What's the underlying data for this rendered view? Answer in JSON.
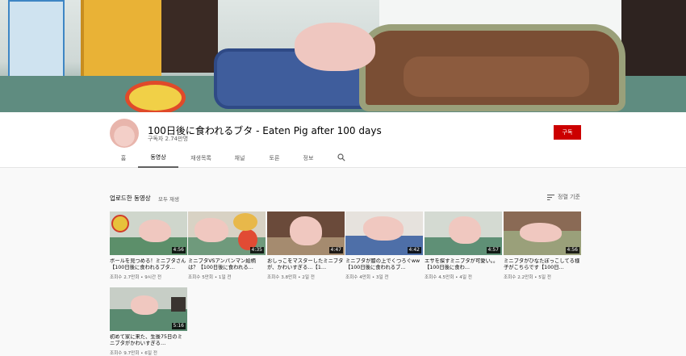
{
  "channel": {
    "title": "100日後に食われるブタ - Eaten Pig after 100 days",
    "subscribers": "구독자 2.74만명",
    "subscribe_label": "구독"
  },
  "tabs": [
    {
      "label": "홈",
      "active": false
    },
    {
      "label": "동영상",
      "active": true
    },
    {
      "label": "재생목록",
      "active": false
    },
    {
      "label": "채널",
      "active": false
    },
    {
      "label": "토론",
      "active": false
    },
    {
      "label": "정보",
      "active": false
    }
  ],
  "section": {
    "title": "업로드한 동영상",
    "play_all": "모두 재생",
    "sort_label": "정렬 기준"
  },
  "icons": {
    "search": "search-icon",
    "sort": "sort-icon"
  },
  "colors": {
    "subscribe": "#cc0000",
    "tab_active_underline": "#606060",
    "duration_bg": "#000000"
  },
  "videos": [
    {
      "duration": "4:56",
      "title": "ボールを見つめる！ミニブタさん【100日後に食われるブタ…",
      "meta": "조회수 2.7만회 • 9시간 전"
    },
    {
      "duration": "4:35",
      "title": "ミニブタVSアンパンマン絵柄は？【100日後に食われる…",
      "meta": "조회수 5만회 • 1일 전"
    },
    {
      "duration": "4:47",
      "title": "おしっこをマスターしたミニブタが、かわいすぎる…【1…",
      "meta": "조회수 3.8만회 • 2일 전"
    },
    {
      "duration": "4:42",
      "title": "ミニブタが膝の上でくつろぐww【100日後に食われるブ…",
      "meta": "조회수 4만회 • 3일 전"
    },
    {
      "duration": "4:57",
      "title": "エサを探すミニブタが可愛い。。【100日後に食わ…",
      "meta": "조회수 4.5만회 • 4일 전"
    },
    {
      "duration": "4:56",
      "title": "ミニブタがひなたぼっこしてる様子がこちらです【100日…",
      "meta": "조회수 2.2만회 • 5일 전"
    },
    {
      "duration": "5:16",
      "title": "初めて家に来た、生後75日のミニブタがかわいすぎる…",
      "meta": "조회수 9.7만회 • 6일 전"
    }
  ]
}
